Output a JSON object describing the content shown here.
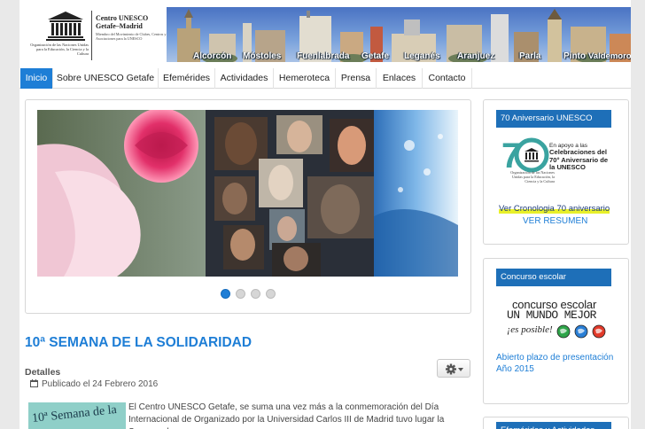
{
  "header": {
    "logo_org_text": "Organización de las Naciones Unidas para la Educación, la Ciencia y la Cultura",
    "center_title_line1": "Centro UNESCO",
    "center_title_line2": "Getafe–Madrid",
    "center_subtitle": "Miembro del Movimiento de Clubes, Centros y Asociaciones para la UNESCO",
    "cities": [
      "Alcorcón",
      "Móstoles",
      "Fuenlabrada",
      "Getafe",
      "Leganés",
      "Aranjuez",
      "Parla",
      "Pinto",
      "Valdemoro"
    ]
  },
  "nav": {
    "items": [
      {
        "label": "Inicio",
        "active": true
      },
      {
        "label": "Sobre UNESCO Getafe",
        "active": false
      },
      {
        "label": "Efemérides",
        "active": false
      },
      {
        "label": "Actividades",
        "active": false
      },
      {
        "label": "Hemeroteca",
        "active": false
      },
      {
        "label": "Prensa",
        "active": false
      },
      {
        "label": "Enlaces",
        "active": false
      },
      {
        "label": "Contacto",
        "active": false
      }
    ]
  },
  "slider": {
    "dot_count": 4,
    "active_dot": 1
  },
  "article": {
    "title": "10ª SEMANA DE LA SOLIDARIDAD",
    "details_label": "Detalles",
    "published": "Publicado el 24 Febrero 2016",
    "thumb_text": "10ª Semana de la",
    "body": "El Centro UNESCO Getafe, se suma una vez más a la conmemoración del Día Internacional de Organizado por la Universidad Carlos III de Madrid tuvo lugar la Semana de"
  },
  "sidebar": {
    "box1": {
      "heading": "70 Aniversario UNESCO",
      "badge_line": "En apoyo a las",
      "badge_bold": "Celebraciones del 70° Aniversario de la UNESCO",
      "badge_org": "Organización de las Naciones Unidas para la Educación, la Ciencia y la Cultura",
      "cronologia_link": "Ver Cronologia 70 aniversario",
      "resumen_link": "VER RESUMEN"
    },
    "box2": {
      "heading": "Concurso escolar",
      "logo_line1": "concurso escolar",
      "logo_line2": "UN MUNDO MEJOR",
      "logo_line3": "¡es posible!",
      "abierto_text": "Abierto plazo de presentación Año 2015"
    },
    "box3": {
      "heading": "Efemérides y Actividades"
    }
  },
  "colors": {
    "accent": "#1e7ed6",
    "sidebar_heading": "#1e6fb8",
    "highlight": "#e8f02a"
  }
}
